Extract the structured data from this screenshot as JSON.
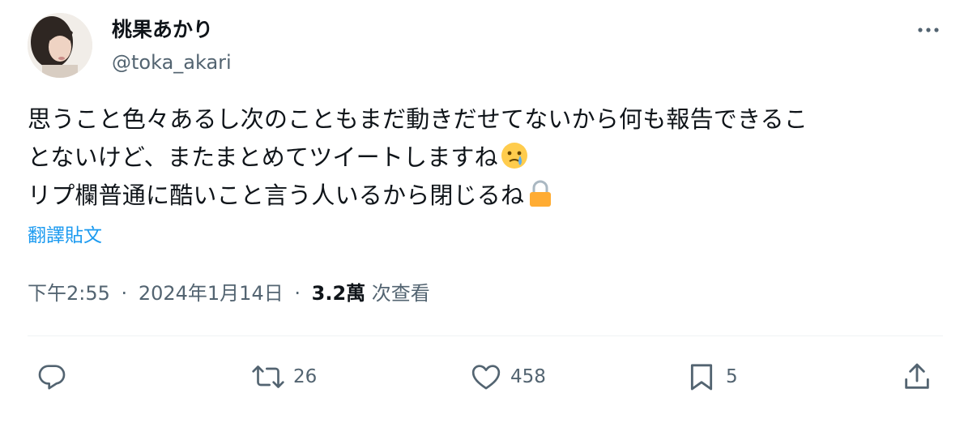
{
  "user": {
    "display_name": "桃果あかり",
    "handle": "@toka_akari"
  },
  "tweet": {
    "line1": "思うこと色々あるし次のこともまだ動きだせてないから何も報告できるこ",
    "line2": "とないけど、またまとめてツイートしますね",
    "line3": "リプ欄普通に酷いこと言う人いるから閉じるね",
    "emoji_line2": "face-holding-back-tears-icon",
    "emoji_line3": "lock-icon"
  },
  "translate_label": "翻譯貼文",
  "meta": {
    "time": "下午2:55",
    "date": "2024年1月14日",
    "separator": "·",
    "views_count": "3.2萬",
    "views_label": "次查看"
  },
  "actions": {
    "reply": {
      "icon": "reply-icon",
      "count": ""
    },
    "retweet": {
      "icon": "retweet-icon",
      "count": "26"
    },
    "like": {
      "icon": "heart-icon",
      "count": "458"
    },
    "bookmark": {
      "icon": "bookmark-icon",
      "count": "5"
    },
    "share": {
      "icon": "share-icon",
      "count": ""
    }
  },
  "colors": {
    "text": "#0f1419",
    "secondary": "#536471",
    "link": "#1d9bf0",
    "divider": "#eff3f4"
  }
}
